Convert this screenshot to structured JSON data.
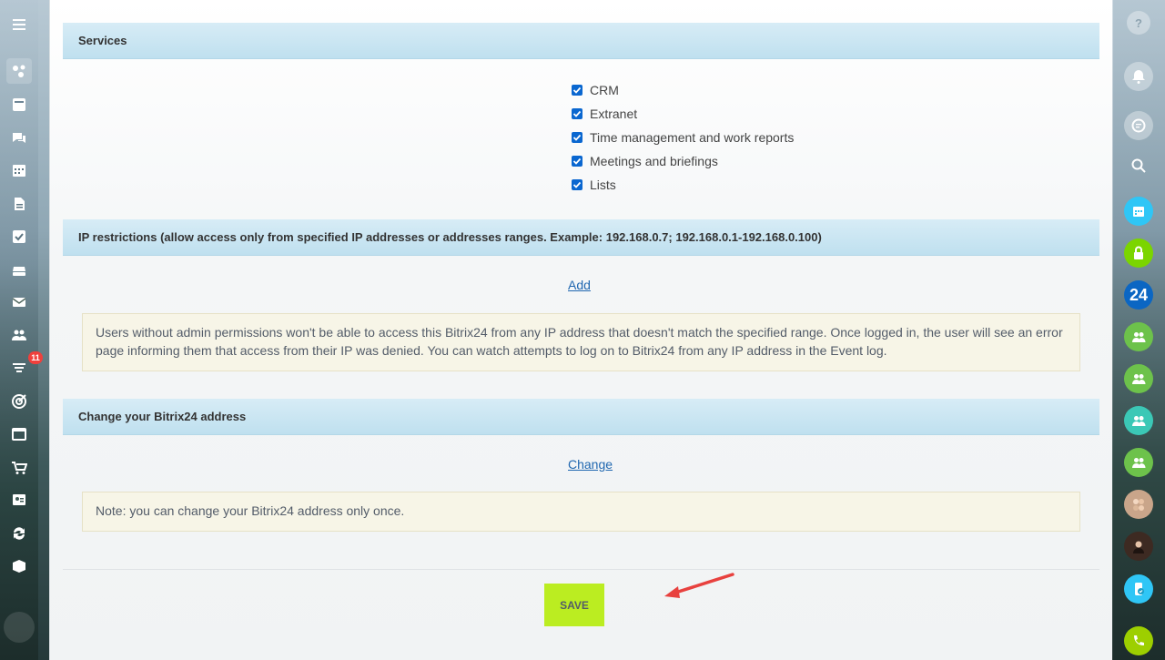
{
  "sections": {
    "services": {
      "title": "Services",
      "items": [
        {
          "label": "CRM",
          "checked": true
        },
        {
          "label": "Extranet",
          "checked": true
        },
        {
          "label": "Time management and work reports",
          "checked": true
        },
        {
          "label": "Meetings and briefings",
          "checked": true
        },
        {
          "label": "Lists",
          "checked": true
        }
      ]
    },
    "ip_restrictions": {
      "title": "IP restrictions (allow access only from specified IP addresses or addresses ranges. Example: 192.168.0.7; 192.168.0.1-192.168.0.100)",
      "link": "Add",
      "note": "Users without admin permissions won't be able to access this Bitrix24 from any IP address that doesn't match the specified range. Once logged in, the user will see an error page informing them that access from their IP was denied. You can watch attempts to log on to Bitrix24 from any IP address in the Event log."
    },
    "address": {
      "title": "Change your Bitrix24 address",
      "link": "Change",
      "note": "Note: you can change your Bitrix24 address only once."
    }
  },
  "save_label": "SAVE",
  "left_sidebar": {
    "icons": [
      "menu-icon",
      "sites-icon",
      "feed-icon",
      "chat-icon",
      "calendar-icon",
      "docs-icon",
      "tasks-icon",
      "drive-icon",
      "mail-icon",
      "groups-icon",
      "crm-funnel-icon",
      "marketing-target-icon",
      "sites-window-icon",
      "shop-cart-icon",
      "contact-center-icon",
      "automation-icon",
      "inventory-box-icon"
    ],
    "crm_badge": "11"
  },
  "right_sidebar": {
    "b24_label": "24",
    "icons": [
      "help-icon",
      "notifications-icon",
      "messenger-icon",
      "search-icon",
      "calendar-icon",
      "lock-icon",
      "bitrix24-icon",
      "group-chat-icon",
      "group-chat-icon",
      "group-chat-icon",
      "group-chat-icon",
      "group-avatars-icon",
      "user-avatar-icon",
      "mobile-app-icon",
      "phone-icon"
    ]
  },
  "colors": {
    "section_header": "#c6e4f2",
    "save_button": "#bbed21",
    "note_background": "#f7f5e7",
    "link": "#2067b0",
    "checkbox": "#0a67d0",
    "arrow": "#e8413e"
  }
}
